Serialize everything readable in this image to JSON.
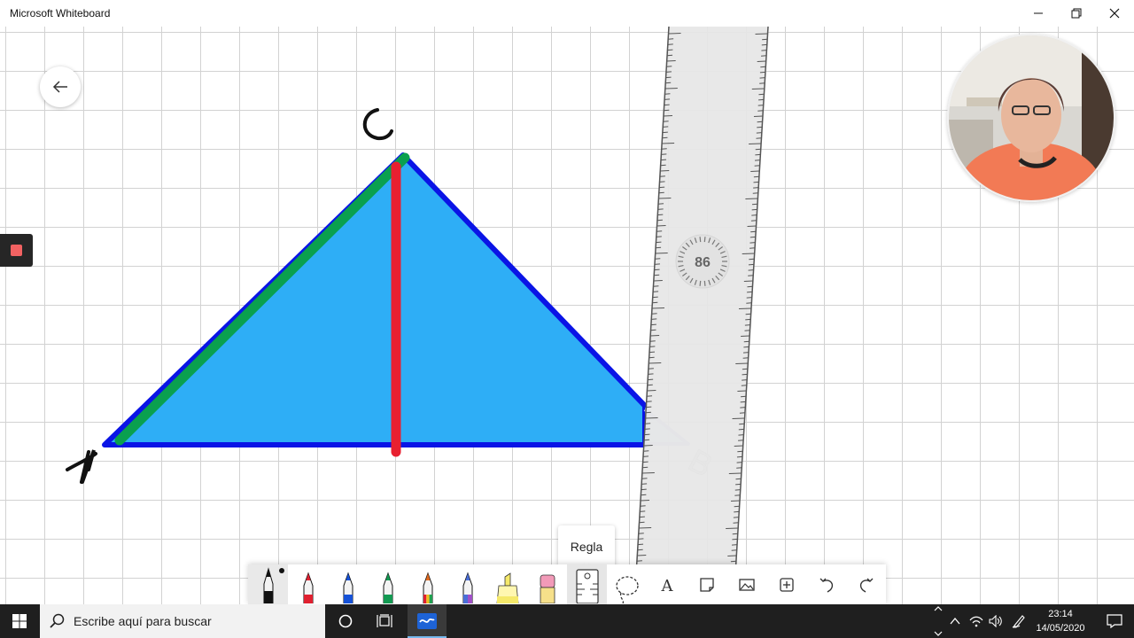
{
  "window": {
    "title": "Microsoft Whiteboard"
  },
  "canvas": {
    "labels": {
      "a": "A",
      "b": "B",
      "c": "C"
    },
    "ruler_angle": "86",
    "colors": {
      "triangle_fill": "#2eaef6",
      "triangle_edge": "#0a14e6",
      "segment_green": "#0aa04f",
      "segment_red": "#e82030"
    }
  },
  "tooltip": {
    "text": "Regla"
  },
  "toolbar": {
    "tools": [
      {
        "name": "pen-black",
        "icon": "pen-icon",
        "color": "#111111",
        "selected": true
      },
      {
        "name": "pen-red",
        "icon": "pen-icon",
        "color": "#e02030"
      },
      {
        "name": "pen-blue",
        "icon": "pen-icon",
        "color": "#1652d8"
      },
      {
        "name": "pen-green",
        "icon": "pen-icon",
        "color": "#139a52"
      },
      {
        "name": "pen-rainbow",
        "icon": "pen-icon",
        "color": "#e06a20"
      },
      {
        "name": "pen-galaxy",
        "icon": "pen-icon",
        "color": "#4a6fd8"
      },
      {
        "name": "highlighter",
        "icon": "highlighter-icon",
        "color": "#f5e96a"
      },
      {
        "name": "eraser",
        "icon": "eraser-icon",
        "color": "#f29ab8"
      },
      {
        "name": "ruler",
        "icon": "ruler-icon",
        "active": true
      },
      {
        "name": "lasso",
        "icon": "lasso-icon"
      },
      {
        "name": "text",
        "icon": "text-icon",
        "glyph": "A"
      },
      {
        "name": "note",
        "icon": "sticky-note-icon"
      },
      {
        "name": "image",
        "icon": "image-icon"
      },
      {
        "name": "add",
        "icon": "add-icon"
      },
      {
        "name": "undo",
        "icon": "undo-icon"
      },
      {
        "name": "redo",
        "icon": "redo-icon"
      }
    ]
  },
  "taskbar": {
    "search_placeholder": "Escribe aquí para buscar",
    "time": "23:14",
    "date": "14/05/2020"
  }
}
